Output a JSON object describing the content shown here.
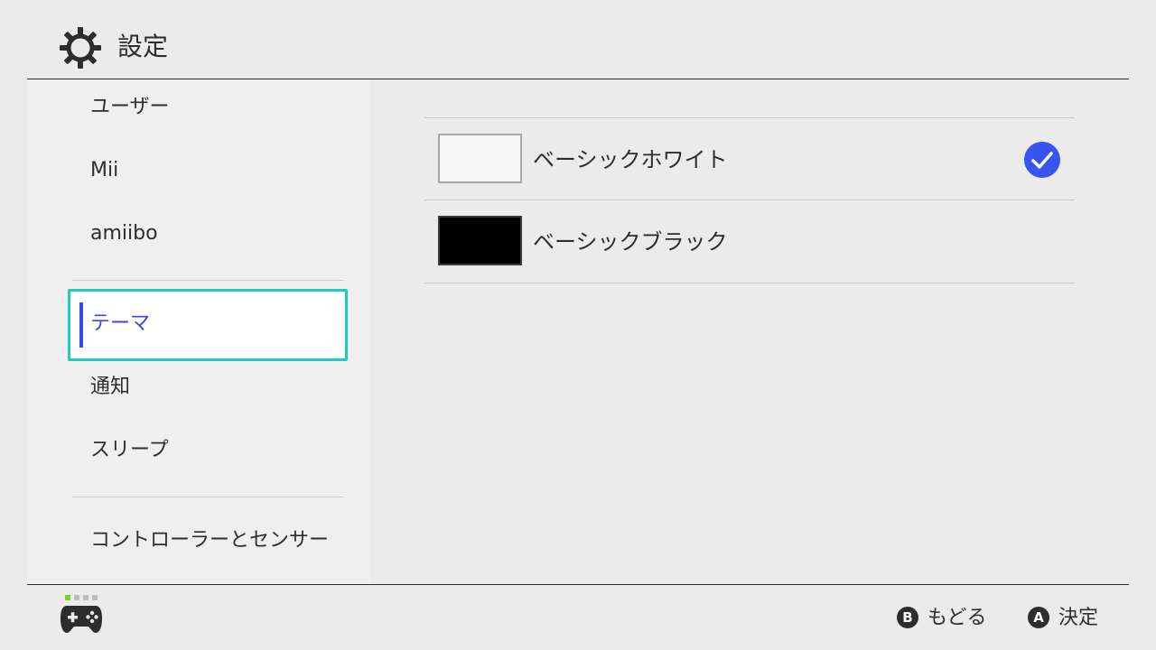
{
  "header": {
    "title": "設定",
    "icon": "gear-icon"
  },
  "sidebar": {
    "items": [
      {
        "label": "ユーザー"
      },
      {
        "label": "Mii"
      },
      {
        "label": "amiibo"
      },
      {
        "label": "テーマ",
        "selected": true
      },
      {
        "label": "通知"
      },
      {
        "label": "スリープ"
      },
      {
        "label": "コントローラーとセンサー"
      }
    ]
  },
  "themes": [
    {
      "label": "ベーシックホワイト",
      "swatch": "#f6f6f6",
      "checked": true
    },
    {
      "label": "ベーシックブラック",
      "swatch": "#000000",
      "checked": false
    }
  ],
  "footer": {
    "back": {
      "button": "B",
      "label": "もどる"
    },
    "confirm": {
      "button": "A",
      "label": "決定"
    }
  },
  "colors": {
    "accent_blue": "#3b4ad9",
    "focus_cyan": "#21c8c4",
    "check_blue": "#3753f0",
    "player_indicator_active": "#7ed321"
  }
}
